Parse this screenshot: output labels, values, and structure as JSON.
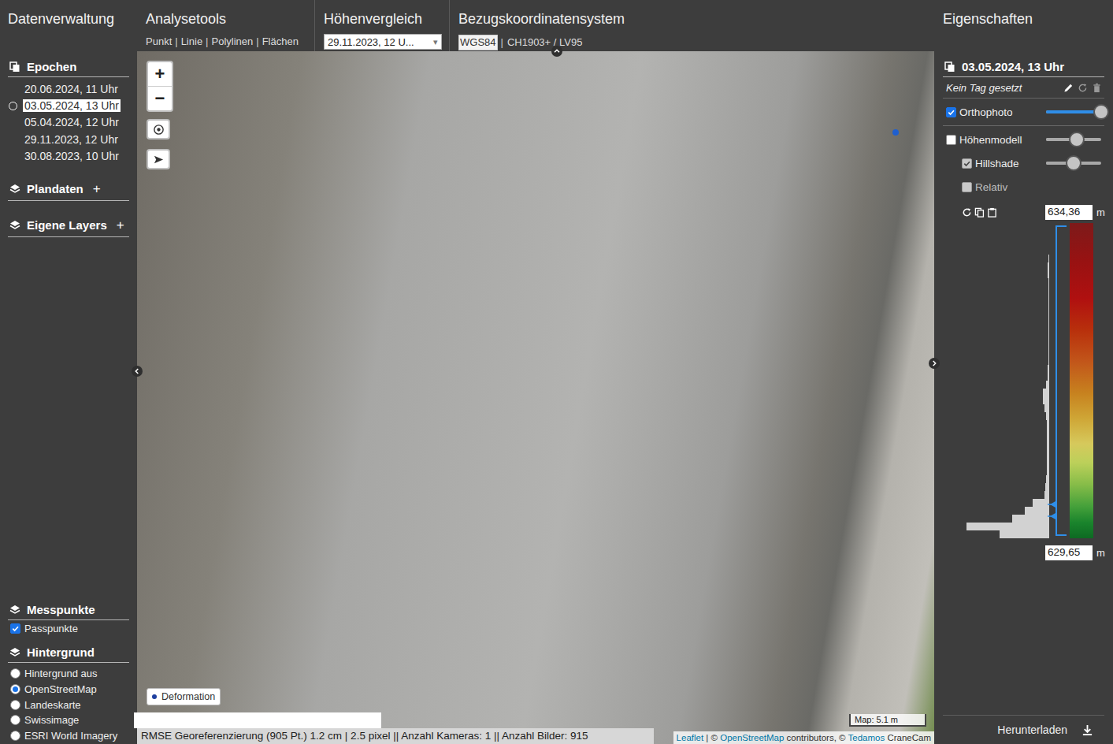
{
  "left_panel": {
    "title": "Datenverwaltung",
    "epochs": {
      "title": "Epochen",
      "items": [
        {
          "label": "20.06.2024, 11 Uhr",
          "selected": false
        },
        {
          "label": "03.05.2024, 13 Uhr",
          "selected": true
        },
        {
          "label": "05.04.2024, 12 Uhr",
          "selected": false
        },
        {
          "label": "29.11.2023, 12 Uhr",
          "selected": false
        },
        {
          "label": "30.08.2023, 10 Uhr",
          "selected": false
        }
      ]
    },
    "plandaten": {
      "title": "Plandaten",
      "add": "+"
    },
    "eigene_layers": {
      "title": "Eigene Layers",
      "add": "+"
    },
    "messpunkte": {
      "title": "Messpunkte",
      "items": [
        {
          "label": "Passpunkte",
          "checked": true
        }
      ]
    },
    "hintergrund": {
      "title": "Hintergrund",
      "items": [
        {
          "label": "Hintergrund aus",
          "selected": false
        },
        {
          "label": "OpenStreetMap",
          "selected": true
        },
        {
          "label": "Landeskarte",
          "selected": false
        },
        {
          "label": "Swissimage",
          "selected": false
        },
        {
          "label": "ESRI World Imagery",
          "selected": false
        }
      ]
    }
  },
  "toolbar": {
    "analysis": {
      "title": "Analysetools",
      "tools": [
        "Punkt",
        "Linie",
        "Polylinen",
        "Flächen"
      ],
      "separator": "|"
    },
    "height_compare": {
      "title": "Höhenvergleich",
      "value": "29.11.2023, 12 U...",
      "arrow": "▾"
    },
    "crs": {
      "title": "Bezugskoordinatensystem",
      "separator": "|",
      "options": [
        {
          "label": "WGS84",
          "selected": true
        },
        {
          "label": "CH1903+ / LV95",
          "selected": false
        }
      ]
    }
  },
  "map": {
    "zoom_in": "+",
    "zoom_out": "−",
    "legend": "Deformation",
    "scale": "Map: 5.1 m",
    "status": "RMSE Georeferenzierung (905 Pt.) 1.2 cm | 2.5 pixel || Anzahl Kameras: 1 || Anzahl Bilder: 915",
    "attribution": [
      {
        "text": "Leaflet",
        "link": true
      },
      {
        "text": " | © ",
        "link": false
      },
      {
        "text": "OpenStreetMap",
        "link": true
      },
      {
        "text": " contributors, © ",
        "link": false
      },
      {
        "text": "Tedamos",
        "link": true
      },
      {
        "text": " CraneCam",
        "link": false
      }
    ]
  },
  "properties": {
    "title": "Eigenschaften",
    "epoch": "03.05.2024, 13 Uhr",
    "tag": "Kein Tag gesetzt",
    "layers": [
      {
        "label": "Orthophoto",
        "kind": "slider",
        "checked": true,
        "disabled": false,
        "nested": false,
        "level": 1.0
      },
      {
        "label": "Höhenmodell",
        "kind": "slider",
        "checked": false,
        "disabled": false,
        "nested": false,
        "level": 0.55
      },
      {
        "label": "Hillshade",
        "kind": "slider",
        "checked": true,
        "disabled": true,
        "nested": true,
        "level": 0.5
      },
      {
        "label": "Relativ",
        "kind": "checkbox",
        "checked": false,
        "disabled": true,
        "nested": true
      }
    ],
    "max_value": "634,36",
    "min_value": "629,65",
    "unit": "m",
    "histogram": {
      "values": [
        0,
        0,
        0,
        0,
        1,
        2,
        2,
        1,
        1,
        1,
        1,
        1,
        1,
        1,
        1,
        1,
        1,
        1,
        2,
        2,
        4,
        8,
        8,
        6,
        4,
        3,
        3,
        3,
        3,
        3,
        3,
        3,
        4,
        5,
        6,
        20,
        30,
        45,
        100,
        60
      ]
    },
    "download": "Herunterladen"
  }
}
